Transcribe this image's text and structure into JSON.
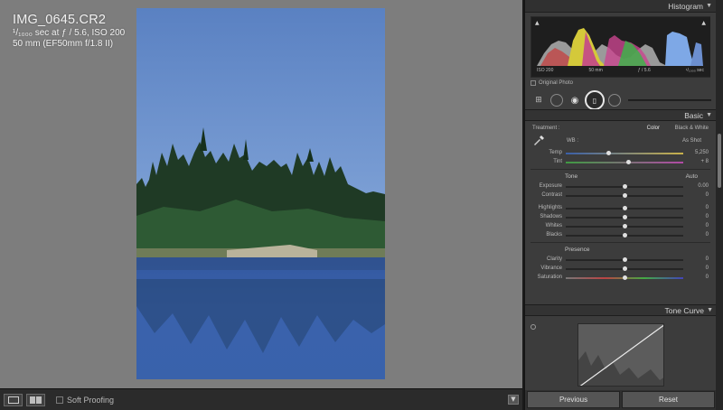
{
  "photo_info": {
    "filename": "IMG_0645.CR2",
    "exposure_line": "¹/₁₀₀₀ sec at ƒ / 5.6, ISO 200",
    "lens_line": "50 mm (EF50mm f/1.8 II)"
  },
  "toolbar": {
    "soft_proofing_label": "Soft Proofing",
    "loupe_icon": "loupe-view-icon",
    "compare_icon": "before-after-icon"
  },
  "histogram": {
    "title": "Histogram",
    "iso": "ISO 200",
    "focal": "50 mm",
    "aperture": "ƒ / 5.6",
    "shutter": "¹/₁₀₀₀ sec",
    "original_photo_label": "Original Photo"
  },
  "basic": {
    "title": "Basic",
    "treatment_label": "Treatment :",
    "color_label": "Color",
    "bw_label": "Black & White",
    "wb_label": "WB :",
    "wb_value": "As Shot",
    "temp": {
      "label": "Temp",
      "value": "5,250",
      "level": 0.36
    },
    "tint": {
      "label": "Tint",
      "value": "+ 8",
      "level": 0.53
    },
    "tone_label": "Tone",
    "auto_label": "Auto",
    "exposure": {
      "label": "Exposure",
      "value": "0.00",
      "level": 0.5
    },
    "contrast": {
      "label": "Contrast",
      "value": "0",
      "level": 0.5
    },
    "highlights": {
      "label": "Highlights",
      "value": "0",
      "level": 0.5
    },
    "shadows": {
      "label": "Shadows",
      "value": "0",
      "level": 0.5
    },
    "whites": {
      "label": "Whites",
      "value": "0",
      "level": 0.5
    },
    "blacks": {
      "label": "Blacks",
      "value": "0",
      "level": 0.5
    },
    "presence_label": "Presence",
    "clarity": {
      "label": "Clarity",
      "value": "0",
      "level": 0.5
    },
    "vibrance": {
      "label": "Vibrance",
      "value": "0",
      "level": 0.5
    },
    "saturation": {
      "label": "Saturation",
      "value": "0",
      "level": 0.5
    }
  },
  "tone_curve": {
    "title": "Tone Curve"
  },
  "buttons": {
    "previous": "Previous",
    "reset": "Reset"
  },
  "colors": {
    "panel_bg": "#3c3c3c",
    "canvas_bg": "#7d7d7d",
    "sky_top": "#5e84c4",
    "sky_bottom": "#93b6e4",
    "water": "#3f66b0"
  }
}
